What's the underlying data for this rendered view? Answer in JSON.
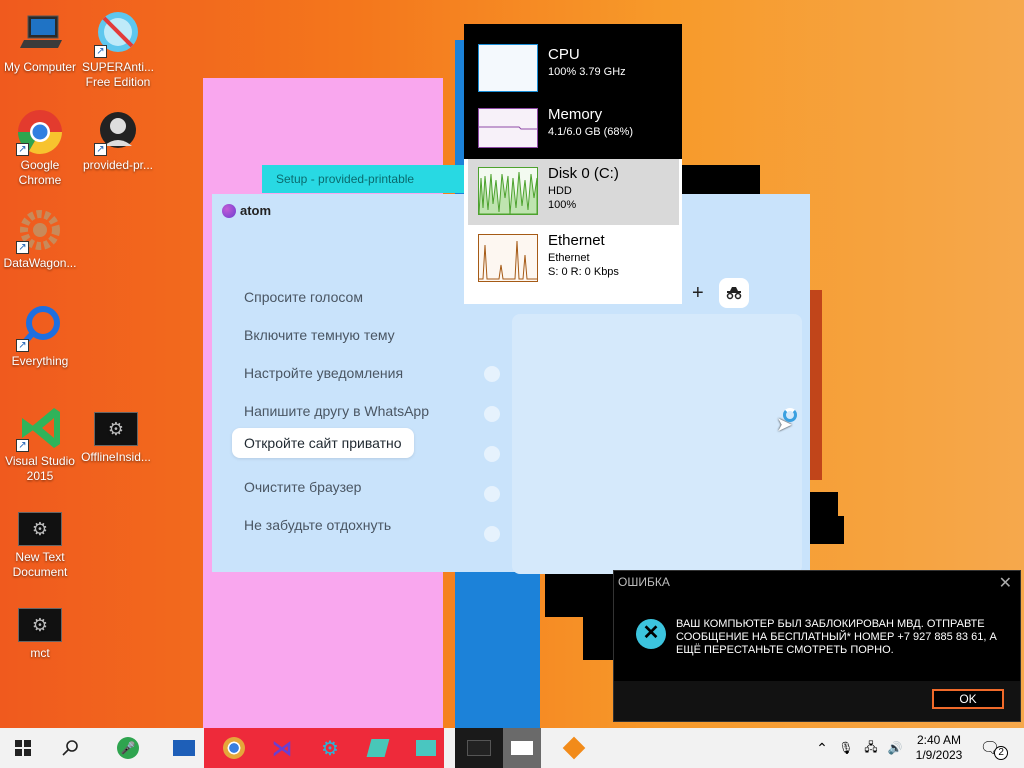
{
  "desktop": {
    "icons": [
      {
        "label": "My Computer",
        "icon": "computer-icon"
      },
      {
        "label": "SUPERAnti...\nFree Edition",
        "icon": "superantispyware-icon"
      },
      {
        "label": "Google\nChrome",
        "icon": "chrome-icon"
      },
      {
        "label": "provided-pr...",
        "icon": "user-icon"
      },
      {
        "label": "DataWagon...",
        "icon": "gear-icon"
      },
      {
        "label": "Everything",
        "icon": "search-icon"
      },
      {
        "label": "Visual Studio\n2015",
        "icon": "visual-studio-icon"
      },
      {
        "label": "OfflineInsid...",
        "icon": "gear-icon"
      },
      {
        "label": "New Text\nDocument",
        "icon": "gear-icon"
      },
      {
        "label": "mct",
        "icon": "gear-icon"
      }
    ]
  },
  "setup_window": {
    "title": "Setup - provided-printable"
  },
  "atom": {
    "logo": "atom",
    "tips": [
      "Спросите голосом",
      "Включите темную тему",
      "Настройте уведомления",
      "Напишите другу в WhatsApp",
      "Откройте сайт приватно",
      "Очистите браузер",
      "Не забудьте отдохнуть"
    ],
    "plus": "+"
  },
  "task_manager": {
    "items": [
      {
        "name": "CPU",
        "line1": "100% 3.79 GHz",
        "line2": ""
      },
      {
        "name": "Memory",
        "line1": "4.1/6.0 GB (68%)",
        "line2": ""
      },
      {
        "name": "Disk 0 (C:)",
        "line1": "HDD",
        "line2": "100%"
      },
      {
        "name": "Ethernet",
        "line1": "Ethernet",
        "line2": "S: 0 R: 0 Kbps"
      }
    ],
    "colors": {
      "cpu": "#1b8ed6",
      "memory": "#8f4aa8",
      "disk": "#4da22e",
      "ethernet": "#a55a16"
    }
  },
  "error_dialog": {
    "title": "ОШИБКА",
    "message": "ВАШ КОМПЬЮТЕР БЫЛ ЗАБЛОКИРОВАН МВД. ОТПРАВТЕ СООБЩЕНИЕ НА БЕСПЛАТНЫЙ* НОМЕР +7 927 885 83 61, А ЕЩЁ ПЕРЕСТАНЬТЕ СМОТРЕТЬ ПОРНО.",
    "ok": "OK",
    "accent": "#f06a2a"
  },
  "taskbar": {
    "time": "2:40 AM",
    "date": "1/9/2023",
    "notifications": "2"
  }
}
